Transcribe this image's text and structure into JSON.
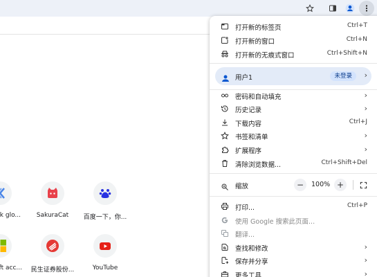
{
  "toolbar": {
    "icons": [
      "star-icon",
      "side-panel-icon",
      "profile-icon",
      "more-vertical-icon"
    ]
  },
  "shortcuts": [
    {
      "label": "rk glo...",
      "icon": "partial-blue-logo"
    },
    {
      "label": "SakuraCat",
      "icon": "sakuracat-logo"
    },
    {
      "label": "百度一下，你...",
      "icon": "baidu-paw-logo"
    },
    {
      "label": "oft acc...",
      "icon": "microsoft-logo"
    },
    {
      "label": "民生证券股份...",
      "icon": "minsheng-logo"
    },
    {
      "label": "YouTube",
      "icon": "youtube-logo"
    }
  ],
  "menu": {
    "new_tab": {
      "label": "打开新的标签页",
      "shortcut": "Ctrl+T"
    },
    "new_window": {
      "label": "打开新的窗口",
      "shortcut": "Ctrl+N"
    },
    "incognito": {
      "label": "打开新的无痕式窗口",
      "shortcut": "Ctrl+Shift+N"
    },
    "user": {
      "label": "用户1",
      "badge": "未登录"
    },
    "passwords": {
      "label": "密码和自动填充"
    },
    "history": {
      "label": "历史记录"
    },
    "downloads": {
      "label": "下载内容",
      "shortcut": "Ctrl+J"
    },
    "bookmarks": {
      "label": "书签和清单"
    },
    "extensions": {
      "label": "扩展程序"
    },
    "clear_data": {
      "label": "清除浏览数据...",
      "shortcut": "Ctrl+Shift+Del"
    },
    "zoom": {
      "label": "缩放",
      "minus": "−",
      "value": "100%",
      "plus": "+"
    },
    "print": {
      "label": "打印...",
      "shortcut": "Ctrl+P"
    },
    "google_search": {
      "label": "使用 Google 搜索此页面..."
    },
    "translate": {
      "label": "翻译..."
    },
    "find_edit": {
      "label": "查找和修改"
    },
    "save_share": {
      "label": "保存并分享"
    },
    "more_tools": {
      "label": "更多工具"
    }
  },
  "colors": {
    "toolbar_bg": "#edf1f8",
    "user_row_bg": "#e3ebf8",
    "badge_bg": "#d3e3fd",
    "profile_blue": "#0b57d0",
    "youtube_red": "#e62117",
    "baidu_blue": "#2932e1",
    "sakura_red": "#e8414b"
  }
}
